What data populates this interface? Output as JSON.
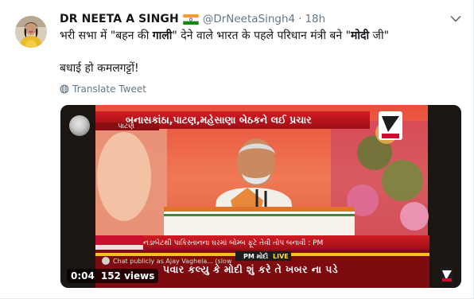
{
  "tweet": {
    "author_name": "DR NEETA A SINGH",
    "handle": "@DrNeetaSingh4",
    "separator": "·",
    "time": "18h",
    "line1_pre": "भरी सभा में \"बहन की ",
    "line1_bold1": "गाली",
    "line1_mid": "\"  देने वाले भारत के पहले परिधान मंत्री बने \"",
    "line1_bold2": "मोदी",
    "line1_post": " जी\"",
    "line2": "बधाई हो कमलगट्टों!",
    "translate_label": "Translate Tweet"
  },
  "video": {
    "headline": "બનાસકાંઠા,પાટણ,મહેસાણા બેઠકને લઈ પ્રચાર",
    "location": "પાટણ",
    "ticker": "નડાબેટથી પાકિસ્તાનના ઘરમાં બોમ્બ ફૂટે તેવી તોપ બનાવી : PM",
    "chat_text": "Chat publicly as Ajay Vaghela... (slow",
    "pm_label": "PM મોદી",
    "live_label": "LIVE",
    "caption": "પવાર કલ્યુ કે મોદી શું કરે તે ખબર ના પડે",
    "elapsed": "0:04",
    "views": "152 views"
  },
  "colors": {
    "text_primary": "#14171a",
    "text_secondary": "#657786",
    "channel_red": "#c8102e",
    "ticker_red": "#b3141c",
    "live_yellow": "#ffdf33"
  }
}
